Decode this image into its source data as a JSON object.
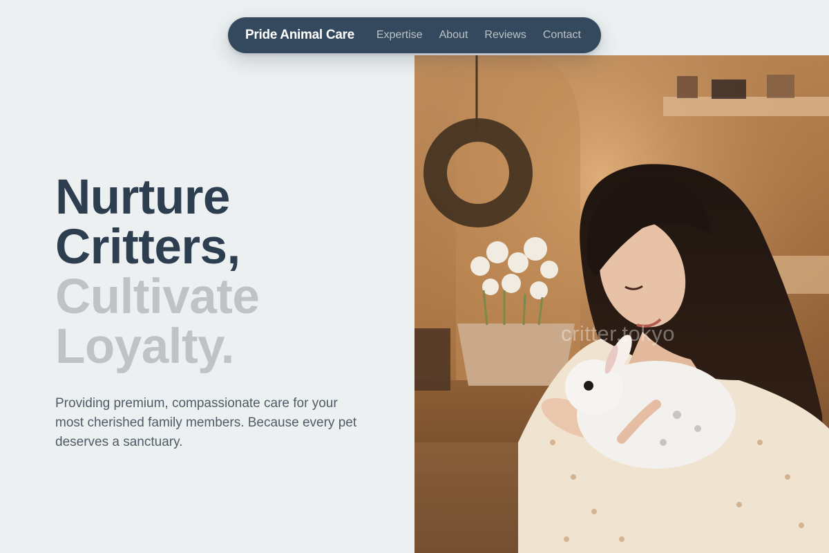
{
  "nav": {
    "brand": "Pride Animal Care",
    "links": [
      "Expertise",
      "About",
      "Reviews",
      "Contact"
    ]
  },
  "hero": {
    "headline_dark": [
      "Nurture",
      "Critters,"
    ],
    "headline_light": [
      "Cultivate",
      "Loyalty."
    ],
    "description": "Providing premium, compassionate care for your most cherished family members. Because every pet deserves a sanctuary.",
    "image": {
      "subject": "woman holding white bunny",
      "watermark": "critter.tokyo"
    }
  },
  "colors": {
    "background": "#ecf0f1",
    "nav_background": "#34495e",
    "headline_dark": "#2c3e50",
    "headline_light": "#bdc3c7",
    "nav_link": "#bdc3c7"
  }
}
